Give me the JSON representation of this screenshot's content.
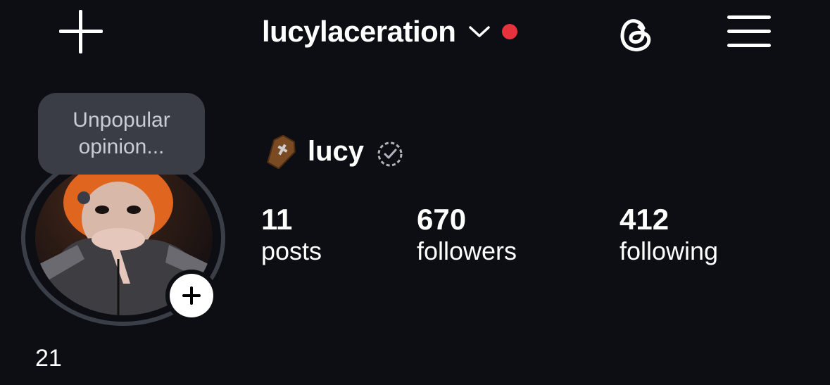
{
  "header": {
    "username": "lucylaceration",
    "notification_dot_color": "#e5323c",
    "icons": [
      "plus-icon",
      "chevron-down-icon",
      "threads-icon",
      "hamburger-menu-icon"
    ]
  },
  "profile": {
    "note": "Unpopular opinion...",
    "display_name": "lucy",
    "name_emoji": "coffin-emoji",
    "age_label": "21",
    "stats": [
      {
        "value": "11",
        "label": "posts"
      },
      {
        "value": "670",
        "label": "followers"
      },
      {
        "value": "412",
        "label": "following"
      }
    ]
  }
}
